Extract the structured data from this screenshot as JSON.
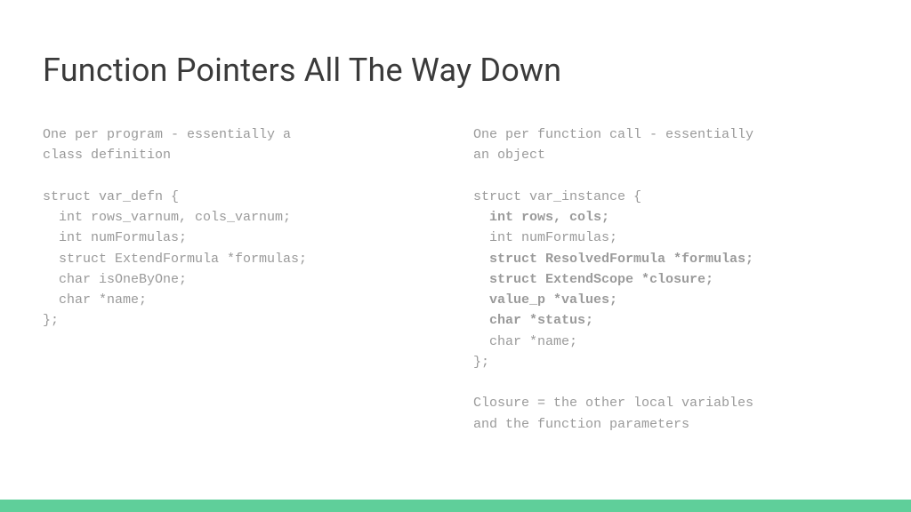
{
  "title": "Function Pointers All The Way Down",
  "left": {
    "heading": "One per program - essentially a\nclass definition",
    "struct_open": "struct var_defn {",
    "line1": "  int rows_varnum, cols_varnum;",
    "line2": "  int numFormulas;",
    "line3": "  struct ExtendFormula *formulas;",
    "line4": "  char isOneByOne;",
    "line5": "  char *name;",
    "struct_close": "};"
  },
  "right": {
    "heading": "One per function call - essentially\nan object",
    "struct_open": "struct var_instance {",
    "line1": "  int rows, cols;",
    "line2": "  int numFormulas;",
    "line3": "  struct ResolvedFormula *formulas;",
    "line4": "  struct ExtendScope *closure;",
    "line5": "  value_p *values;",
    "line6": "  char *status;",
    "line7": "  char *name;",
    "struct_close": "};",
    "footer": "Closure = the other local variables\nand the function parameters"
  }
}
